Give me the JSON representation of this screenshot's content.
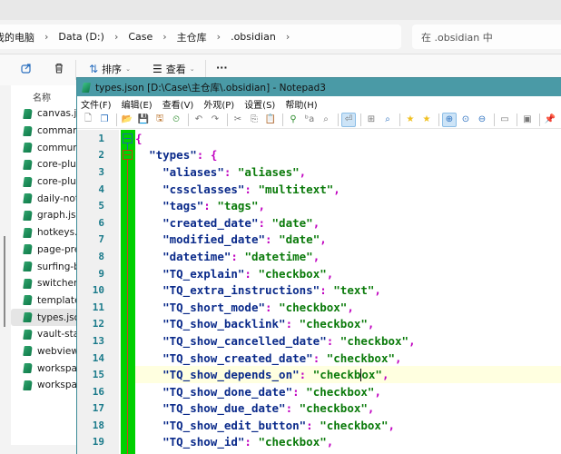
{
  "explorer": {
    "breadcrumbs": [
      "我的电脑",
      "Data (D:)",
      "Case",
      "主仓库",
      ".obsidian"
    ],
    "search_placeholder": "在 .obsidian 中",
    "toolbar": {
      "share_icon": "share-icon",
      "delete_icon": "trash-icon",
      "sort_label": "排序",
      "view_label": "查看",
      "more_label": "···"
    },
    "column_header": "名称",
    "files": [
      {
        "name": "canvas.json"
      },
      {
        "name": "command-palette.json"
      },
      {
        "name": "community-plugins.json"
      },
      {
        "name": "core-plugins.json"
      },
      {
        "name": "core-plugins-migration.json"
      },
      {
        "name": "daily-notes.json"
      },
      {
        "name": "graph.json"
      },
      {
        "name": "hotkeys.json"
      },
      {
        "name": "page-preview.json"
      },
      {
        "name": "surfing-bookmark.json"
      },
      {
        "name": "switcher.json"
      },
      {
        "name": "templates.json"
      },
      {
        "name": "types.json",
        "selected": true
      },
      {
        "name": "vault-stats.json"
      },
      {
        "name": "webviewer.json"
      },
      {
        "name": "workspace.json"
      },
      {
        "name": "workspace-mobile.json"
      }
    ]
  },
  "notepad": {
    "title": "types.json [D:\\Case\\主仓库\\.obsidian] - Notepad3",
    "menu": [
      "文件(F)",
      "编辑(E)",
      "查看(V)",
      "外观(P)",
      "设置(S)",
      "帮助(H)"
    ],
    "toolbar_icons": [
      "new-file-icon",
      "new-window-icon",
      "open-icon",
      "save-icon",
      "save-as-icon",
      "recent-icon",
      "undo-icon",
      "redo-icon",
      "cut-icon",
      "copy-icon",
      "paste-icon",
      "find-icon",
      "replace-icon",
      "goto-icon",
      "word-wrap-icon",
      "fold-icon",
      "find-next-icon",
      "favorite-icon",
      "add-favorite-icon",
      "zoom-in-icon",
      "zoom-reset-icon",
      "zoom-out-icon",
      "view-icon",
      "terminal-icon",
      "pin-icon"
    ],
    "current_line": 15,
    "lines": [
      {
        "n": "1",
        "indent": "",
        "open": "{"
      },
      {
        "n": "2",
        "indent": "  ",
        "key": "\"types\"",
        "open": "{"
      },
      {
        "n": "3",
        "indent": "    ",
        "key": "\"aliases\"",
        "value": "\"aliases\""
      },
      {
        "n": "4",
        "indent": "    ",
        "key": "\"cssclasses\"",
        "value": "\"multitext\""
      },
      {
        "n": "5",
        "indent": "    ",
        "key": "\"tags\"",
        "value": "\"tags\""
      },
      {
        "n": "6",
        "indent": "    ",
        "key": "\"created_date\"",
        "value": "\"date\""
      },
      {
        "n": "7",
        "indent": "    ",
        "key": "\"modified_date\"",
        "value": "\"date\""
      },
      {
        "n": "8",
        "indent": "    ",
        "key": "\"datetime\"",
        "value": "\"datetime\""
      },
      {
        "n": "9",
        "indent": "    ",
        "key": "\"TQ_explain\"",
        "value": "\"checkbox\""
      },
      {
        "n": "10",
        "indent": "    ",
        "key": "\"TQ_extra_instructions\"",
        "value": "\"text\""
      },
      {
        "n": "11",
        "indent": "    ",
        "key": "\"TQ_short_mode\"",
        "value": "\"checkbox\""
      },
      {
        "n": "12",
        "indent": "    ",
        "key": "\"TQ_show_backlink\"",
        "value": "\"checkbox\""
      },
      {
        "n": "13",
        "indent": "    ",
        "key": "\"TQ_show_cancelled_date\"",
        "value": "\"checkbox\""
      },
      {
        "n": "14",
        "indent": "    ",
        "key": "\"TQ_show_created_date\"",
        "value": "\"checkbox\""
      },
      {
        "n": "15",
        "indent": "    ",
        "key": "\"TQ_show_depends_on\"",
        "value": "\"checkbox\"",
        "caret_after": 7
      },
      {
        "n": "16",
        "indent": "    ",
        "key": "\"TQ_show_done_date\"",
        "value": "\"checkbox\""
      },
      {
        "n": "17",
        "indent": "    ",
        "key": "\"TQ_show_due_date\"",
        "value": "\"checkbox\""
      },
      {
        "n": "18",
        "indent": "    ",
        "key": "\"TQ_show_edit_button\"",
        "value": "\"checkbox\""
      },
      {
        "n": "19",
        "indent": "    ",
        "key": "\"TQ_show_id\"",
        "value": "\"checkbox\""
      }
    ]
  },
  "colors": {
    "title_bar": "#4a9aa6",
    "fold_margin": "#00d000",
    "line_number": "#1a7a8a",
    "json_key": "#0a2a8a",
    "json_string": "#0a7a0a",
    "json_punct": "#c000c0",
    "current_line_bg": "#ffffe0"
  }
}
